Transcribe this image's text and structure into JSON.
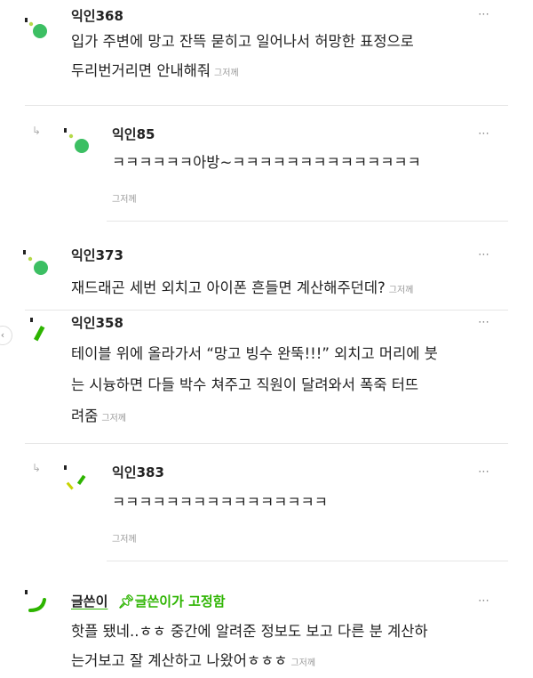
{
  "comments": [
    {
      "name": "익인368",
      "lines": [
        "입가 주변에 망고 잔뜩 묻히고 일어나서 허망한 표정으로",
        "두리번거리면 안내해줘"
      ],
      "meta": "그저께"
    },
    {
      "name": "익인85",
      "lines": [
        "ㅋㅋㅋㅋㅋㅋ아방~ㅋㅋㅋㅋㅋㅋㅋㅋㅋㅋㅋㅋㅋㅋ"
      ],
      "meta": "그저께"
    },
    {
      "name": "익인373",
      "lines": [
        "재드래곤 세번 외치고 아이폰 흔들면 계산해주던데?"
      ],
      "meta": "그저께"
    },
    {
      "name": "익인358",
      "lines": [
        "테이블 위에 올라가서 “망고 빙수 완뚝!!!” 외치고 머리에 붓",
        "는 시늉하면 다들 박수 쳐주고 직원이 달려와서 폭죽 터뜨",
        "려줌"
      ],
      "meta": "그저께"
    },
    {
      "name": "익인383",
      "lines": [
        "ㅋㅋㅋㅋㅋㅋㅋㅋㅋㅋㅋㅋㅋㅋㅋㅋ"
      ],
      "meta": "그저께"
    },
    {
      "name": "글쓴이",
      "pinned": "글쓴이가 고정함",
      "lines": [
        "핫플 됐네..ㅎㅎ 중간에 알려준 정보도 보고 다른 분 계산하",
        "는거보고 잘 계산하고 나왔어ㅎㅎㅎ"
      ],
      "meta": "그저께"
    }
  ],
  "more_icon": "⋯",
  "colors": {
    "accent_green": "#2db400",
    "avatar_green": "#3cbf63"
  }
}
